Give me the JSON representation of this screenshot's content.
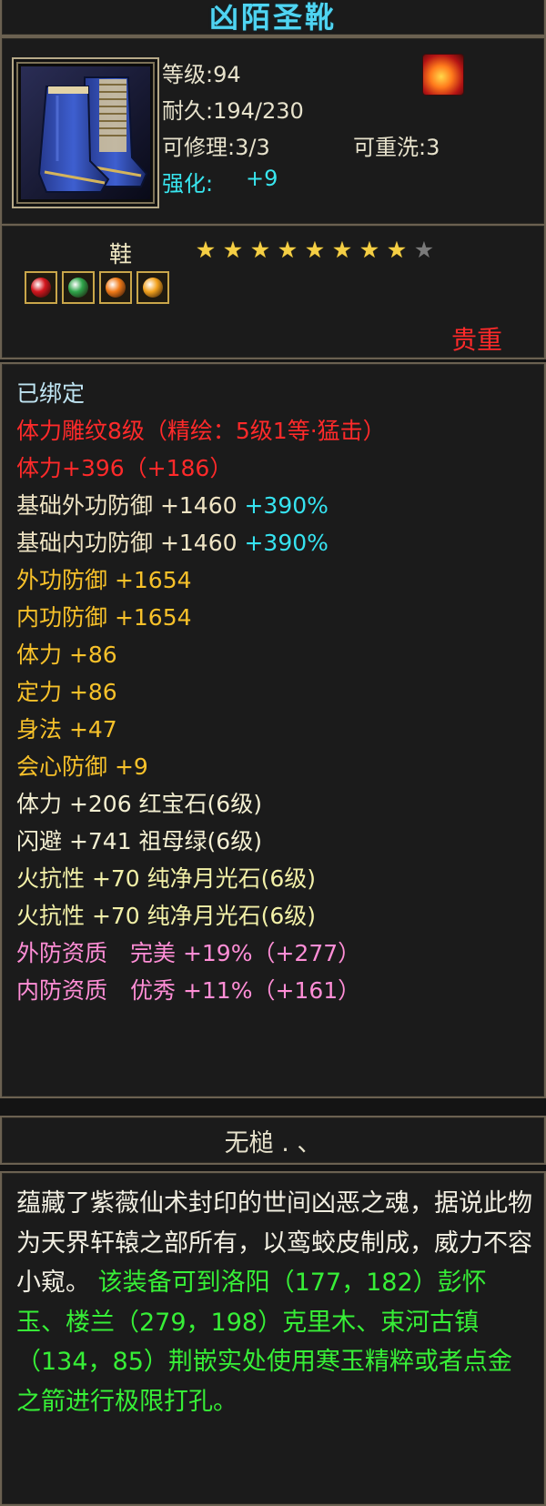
{
  "item": {
    "name": "凶陌圣靴",
    "level": "等级:94",
    "durability": "耐久:194/230",
    "repairable": "可修理:3/3",
    "rewashable": "可重洗:3",
    "enhance_label": "强化:",
    "enhance_value": "+9",
    "slot": "鞋",
    "stars_filled": 8,
    "stars_total": 9,
    "rarity": "贵重"
  },
  "gems": [
    {
      "name": "ruby-gem",
      "color": "#d3161d"
    },
    {
      "name": "emerald-gem",
      "color": "#2fa54a"
    },
    {
      "name": "fire-gem-1",
      "color": "#f07a18"
    },
    {
      "name": "fire-gem-2",
      "color": "#f3a21e"
    }
  ],
  "attributes": [
    {
      "segments": [
        {
          "text": "已绑定",
          "color": "#bfe4f2"
        }
      ]
    },
    {
      "segments": [
        {
          "text": "体力雕纹8级（精绘：5级1等·猛击）",
          "color": "#ff2a2a"
        }
      ]
    },
    {
      "segments": [
        {
          "text": "体力+396（+186）",
          "color": "#ff2a2a"
        }
      ]
    },
    {
      "segments": [
        {
          "text": "基础外功防御 +1460 ",
          "color": "#efe4c4"
        },
        {
          "text": "+390%",
          "color": "#36e3f0"
        }
      ]
    },
    {
      "segments": [
        {
          "text": "基础内功防御 +1460 ",
          "color": "#efe4c4"
        },
        {
          "text": "+390%",
          "color": "#36e3f0"
        }
      ]
    },
    {
      "segments": [
        {
          "text": "外功防御 +1654",
          "color": "#f7c12a"
        }
      ]
    },
    {
      "segments": [
        {
          "text": "内功防御 +1654",
          "color": "#f7c12a"
        }
      ]
    },
    {
      "segments": [
        {
          "text": "体力 +86",
          "color": "#f7c12a"
        }
      ]
    },
    {
      "segments": [
        {
          "text": "定力 +86",
          "color": "#f7c12a"
        }
      ]
    },
    {
      "segments": [
        {
          "text": "身法 +47",
          "color": "#f7c12a"
        }
      ]
    },
    {
      "segments": [
        {
          "text": "会心防御 +9",
          "color": "#f7c12a"
        }
      ]
    },
    {
      "segments": [
        {
          "text": "体力 +206 红宝石(6级)",
          "color": "#f3efd2"
        }
      ]
    },
    {
      "segments": [
        {
          "text": "闪避 +741 祖母绿(6级)",
          "color": "#f3efd2"
        }
      ]
    },
    {
      "segments": [
        {
          "text": "火抗性 +70 纯净月光石(6级)",
          "color": "#f3f1a8"
        }
      ]
    },
    {
      "segments": [
        {
          "text": "火抗性 +70 纯净月光石(6级)",
          "color": "#f3f1a8"
        }
      ]
    },
    {
      "segments": [
        {
          "text": "外防资质　完美 +19%（+277）",
          "color": "#ff8ed6"
        }
      ]
    },
    {
      "segments": [
        {
          "text": "内防资质　优秀 +11%（+161）",
          "color": "#ff8ed6"
        }
      ]
    }
  ],
  "separator": "无槌 . 、",
  "description": {
    "lore": "蕴藏了紫薇仙术封印的世间凶恶之魂，据说此物为天界轩辕之部所有，以鸾蛟皮制成，威力不容小窥。",
    "hint": "该装备可到洛阳（177，182）彭怀玉、楼兰（279，198）克里木、束河古镇（134，85）荆嵌实处使用寒玉精粹或者点金之箭进行极限打孔。"
  }
}
